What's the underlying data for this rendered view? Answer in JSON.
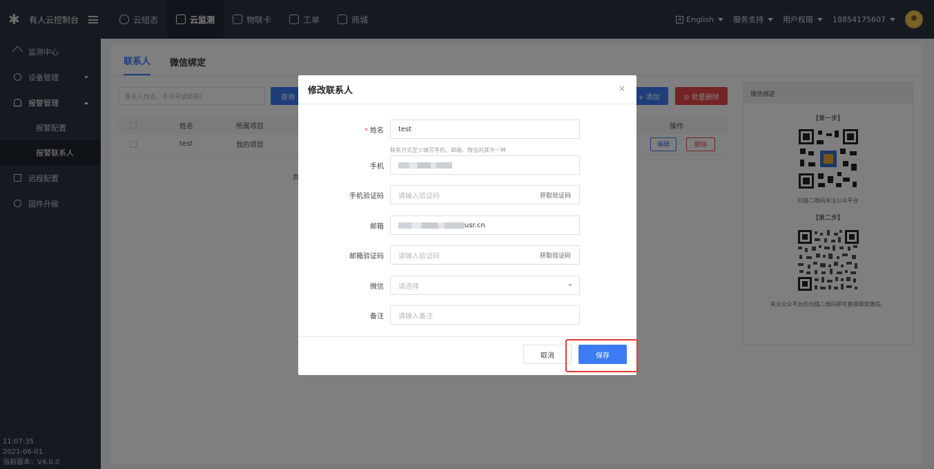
{
  "colors": {
    "topbar": "#2b3442",
    "primary": "#3d7bf5",
    "danger": "#e84949",
    "highlight": "#e53935"
  },
  "header": {
    "logo_icon": "runner-logo-icon",
    "brand": "有人云控制台",
    "nav": [
      {
        "icon": "cloud-icon",
        "label": "云组态"
      },
      {
        "icon": "monitor-icon",
        "label": "云监测"
      },
      {
        "icon": "sim-card-icon",
        "label": "物联卡"
      },
      {
        "icon": "ticket-icon",
        "label": "工单"
      },
      {
        "icon": "store-icon",
        "label": "商城"
      }
    ],
    "lang": "English",
    "service": "服务支持",
    "perm": "用户权限",
    "user": "18854175607"
  },
  "sidebar": {
    "items": [
      {
        "icon": "home-icon",
        "label": "监测中心"
      },
      {
        "icon": "device-icon",
        "label": "设备管理"
      },
      {
        "icon": "alarm-icon",
        "label": "报警管理"
      },
      {
        "label": "报警配置"
      },
      {
        "label": "报警联系人"
      },
      {
        "icon": "remote-icon",
        "label": "远程配置"
      },
      {
        "icon": "firmware-icon",
        "label": "固件升级"
      }
    ],
    "time": "11:07:35",
    "date": "2021-06-01",
    "version": "当前版本：V4.0.0"
  },
  "main": {
    "tabs": [
      "联系人",
      "微信绑定"
    ],
    "search_placeholder": "联系人姓名、手机号或邮箱!",
    "query": "查询",
    "add": "+ 添加",
    "batch_delete": "⊘ 批量删除",
    "table": {
      "headers": {
        "name": "姓名",
        "project": "所属项目",
        "ops": "操作"
      },
      "rows": [
        {
          "name": "test",
          "project": "我的项目",
          "edit": "编辑",
          "delete": "删除"
        }
      ],
      "total": "共"
    },
    "wechat": {
      "title": "微信绑定",
      "step1": "【第一步】",
      "step1_note": "扫描二维码关注公众平台",
      "step2": "【第二步】",
      "step2_note": "关注公众平台后扫描二维码即可直接绑定微信。"
    }
  },
  "dialog": {
    "title": "修改联系人",
    "close": "×",
    "name_label": "姓名",
    "name_value": "test",
    "hint": "联系方式至少填写手机、邮箱、微信的其中一种",
    "phone_label": "手机",
    "phone_code_label": "手机验证码",
    "phone_code_placeholder": "请输入验证码",
    "get_code": "获取验证码",
    "email_label": "邮箱",
    "email_value_suffix": "usr.cn",
    "email_code_label": "邮箱验证码",
    "email_code_placeholder": "请输入验证码",
    "wechat_label": "微信",
    "wechat_placeholder": "请选择",
    "remark_label": "备注",
    "remark_placeholder": "请输入备注",
    "cancel": "取消",
    "save": "保存"
  }
}
